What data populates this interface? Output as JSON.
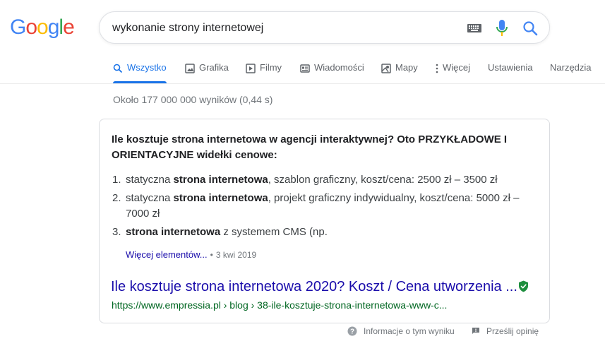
{
  "logo": {
    "letters": [
      "G",
      "o",
      "o",
      "g",
      "l",
      "e"
    ],
    "colors": [
      "#4285f4",
      "#ea4335",
      "#fbbc05",
      "#4285f4",
      "#34a853",
      "#ea4335"
    ]
  },
  "search": {
    "query": "wykonanie strony internetowej"
  },
  "tabs": [
    {
      "label": "Wszystko",
      "icon": "search-icon",
      "active": true
    },
    {
      "label": "Grafika",
      "icon": "image-icon"
    },
    {
      "label": "Filmy",
      "icon": "play-icon"
    },
    {
      "label": "Wiadomości",
      "icon": "news-icon"
    },
    {
      "label": "Mapy",
      "icon": "map-icon"
    },
    {
      "label": "Więcej",
      "icon": "more-vert-icon"
    },
    {
      "label": "Ustawienia"
    },
    {
      "label": "Narzędzia"
    }
  ],
  "stats": "Około 177 000 000 wyników (0,44 s)",
  "snippet": {
    "question": "Ile kosztuje strona internetowa w agencji interaktywnej? Oto PRZYKŁADOWE I ORIENTACYJNE widełki cenowe:",
    "items": [
      {
        "num": "1.",
        "pre": "statyczna ",
        "bold": "strona internetowa",
        "post": ", szablon graficzny, koszt/cena: 2500 zł – 3500 zł"
      },
      {
        "num": "2.",
        "pre": "statyczna ",
        "bold": "strona internetowa",
        "post": ", projekt graficzny indywidualny, koszt/cena: 5000 zł – 7000 zł"
      },
      {
        "num": "3.",
        "pre": "",
        "bold": "strona internetowa",
        "post": " z systemem CMS (np."
      }
    ],
    "more_label": "Więcej elementów...",
    "separator": "•",
    "date": "3 kwi 2019",
    "result_title": "Ile kosztuje strona internetowa 2020? Koszt / Cena utworzenia ...",
    "result_url": "https://www.empressia.pl › blog › 38-ile-kosztuje-strona-internetowa-www-c..."
  },
  "footer": {
    "about_label": "Informacje o tym wyniku",
    "feedback_label": "Prześlij opinię"
  },
  "colors": {
    "accent": "#1a73e8",
    "link": "#1a0dab",
    "url": "#006621",
    "verified": "#1e8e3e"
  }
}
